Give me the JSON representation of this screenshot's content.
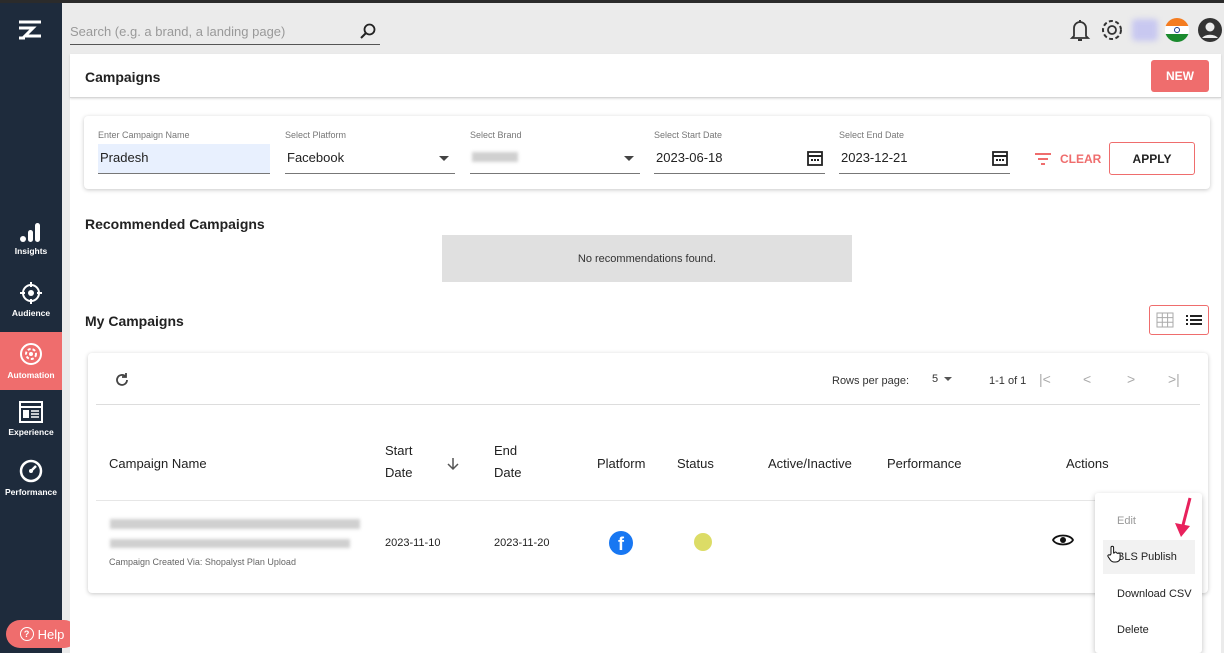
{
  "sidebar": {
    "items": [
      {
        "label": "Insights",
        "icon": "bar-chart-icon"
      },
      {
        "label": "Audience",
        "icon": "target-icon"
      },
      {
        "label": "Automation",
        "icon": "automation-gear-icon",
        "active": true
      },
      {
        "label": "Experience",
        "icon": "experience-icon"
      },
      {
        "label": "Performance",
        "icon": "gauge-icon"
      }
    ],
    "help_label": "Help"
  },
  "search": {
    "placeholder": "Search (e.g. a brand, a landing page)"
  },
  "header": {
    "title": "Campaigns",
    "new_label": "NEW"
  },
  "filters": {
    "campaign_name": {
      "label": "Enter Campaign Name",
      "value": "Pradesh"
    },
    "platform": {
      "label": "Select Platform",
      "value": "Facebook"
    },
    "brand": {
      "label": "Select Brand",
      "value": ""
    },
    "start_date": {
      "label": "Select Start Date",
      "value": "2023-06-18"
    },
    "end_date": {
      "label": "Select End Date",
      "value": "2023-12-21"
    },
    "clear_label": "CLEAR",
    "apply_label": "APPLY"
  },
  "recommended": {
    "title": "Recommended Campaigns",
    "empty_text": "No recommendations found."
  },
  "my_campaigns": {
    "title": "My Campaigns"
  },
  "table": {
    "rows_per_page_label": "Rows per page:",
    "rows_per_page": "5",
    "range": "1-1 of 1",
    "columns": {
      "campaign_name": "Campaign Name",
      "start_date_1": "Start",
      "start_date_2": "Date",
      "end_date_1": "End",
      "end_date_2": "Date",
      "platform": "Platform",
      "status": "Status",
      "active": "Active/Inactive",
      "performance": "Performance",
      "actions": "Actions"
    },
    "rows": [
      {
        "created_via": "Campaign Created Via: Shopalyst Plan Upload",
        "start_date": "2023-11-10",
        "end_date": "2023-11-20",
        "platform_icon": "facebook-icon",
        "status_color": "#dcdc66"
      }
    ]
  },
  "actions_menu": {
    "edit": "Edit",
    "publish": "BLS Publish",
    "download": "Download CSV",
    "delete": "Delete"
  },
  "colors": {
    "accent": "#ef6d6d",
    "sidebar": "#1e2b3c"
  }
}
